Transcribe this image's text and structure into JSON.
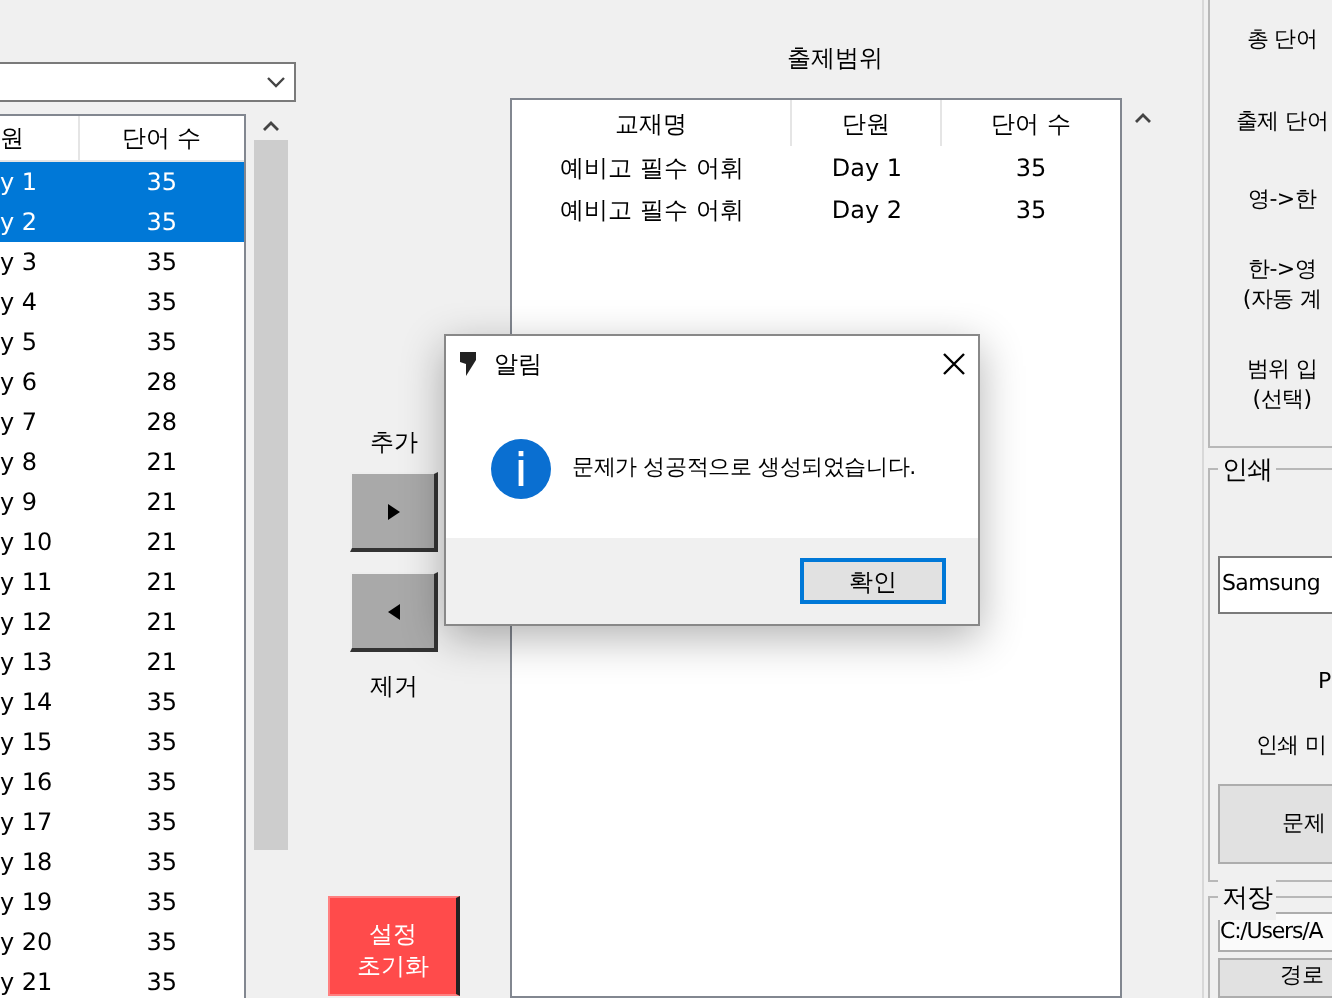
{
  "source": {
    "columns": [
      "원",
      "단어 수"
    ],
    "rows": [
      {
        "unit": "y 1",
        "words": "35",
        "selected": true
      },
      {
        "unit": "y 2",
        "words": "35",
        "selected": true
      },
      {
        "unit": "y 3",
        "words": "35",
        "selected": false
      },
      {
        "unit": "y 4",
        "words": "35",
        "selected": false
      },
      {
        "unit": "y 5",
        "words": "35",
        "selected": false
      },
      {
        "unit": "y 6",
        "words": "28",
        "selected": false
      },
      {
        "unit": "y 7",
        "words": "28",
        "selected": false
      },
      {
        "unit": "y 8",
        "words": "21",
        "selected": false
      },
      {
        "unit": "y 9",
        "words": "21",
        "selected": false
      },
      {
        "unit": "y 10",
        "words": "21",
        "selected": false
      },
      {
        "unit": "y 11",
        "words": "21",
        "selected": false
      },
      {
        "unit": "y 12",
        "words": "21",
        "selected": false
      },
      {
        "unit": "y 13",
        "words": "21",
        "selected": false
      },
      {
        "unit": "y 14",
        "words": "35",
        "selected": false
      },
      {
        "unit": "y 15",
        "words": "35",
        "selected": false
      },
      {
        "unit": "y 16",
        "words": "35",
        "selected": false
      },
      {
        "unit": "y 17",
        "words": "35",
        "selected": false
      },
      {
        "unit": "y 18",
        "words": "35",
        "selected": false
      },
      {
        "unit": "y 19",
        "words": "35",
        "selected": false
      },
      {
        "unit": "y 20",
        "words": "35",
        "selected": false
      },
      {
        "unit": "y 21",
        "words": "35",
        "selected": false
      }
    ]
  },
  "move": {
    "add_label": "추가",
    "remove_label": "제거"
  },
  "reset_button": {
    "lines": [
      "설정",
      "초기화"
    ]
  },
  "range": {
    "title": "출제범위",
    "columns": [
      "교재명",
      "단원",
      "단어 수"
    ],
    "rows": [
      {
        "book": "예비고 필수 어휘",
        "unit": "Day 1",
        "words": "35"
      },
      {
        "book": "예비고 필수 어휘",
        "unit": "Day 2",
        "words": "35"
      }
    ]
  },
  "settings": {
    "labels": [
      [
        "총 단어"
      ],
      [
        "출제 단어"
      ],
      [
        "영->한"
      ],
      [
        "한->영",
        "(자동 계"
      ],
      [
        "범위 입",
        "(선택)"
      ]
    ]
  },
  "print": {
    "title": "인쇄",
    "printer": "Samsung",
    "label_1": "P",
    "label_2": "인쇄 미",
    "button": "문제"
  },
  "save": {
    "title": "저장",
    "path": "C:/Users/A",
    "button": "경로"
  },
  "dialog": {
    "title": "알림",
    "message": "문제가 성공적으로 생성되었습니다.",
    "ok": "확인"
  }
}
